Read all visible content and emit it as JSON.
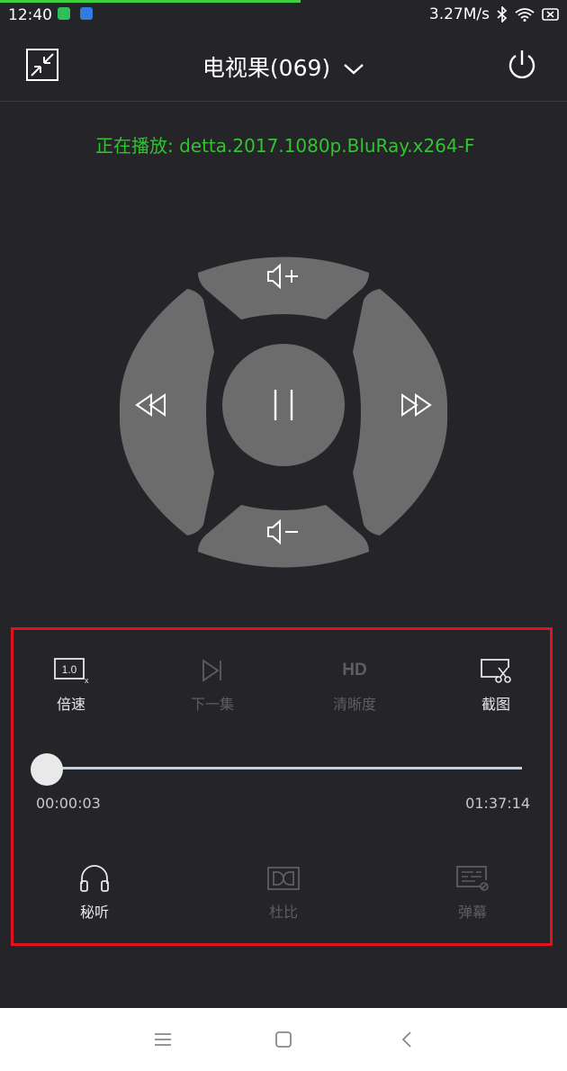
{
  "statusbar": {
    "time": "12:40",
    "speed": "3.27M/s"
  },
  "header": {
    "title": "电视果(069)"
  },
  "now_playing": {
    "text": "正在播放: detta.2017.1080p.BluRay.x264-F"
  },
  "controls": {
    "row1": [
      {
        "label": "倍速",
        "icon_text": "1.0",
        "enabled": true
      },
      {
        "label": "下一集",
        "enabled": false
      },
      {
        "label": "清晰度",
        "icon_text": "HD",
        "enabled": false
      },
      {
        "label": "截图",
        "enabled": true
      }
    ],
    "progress": {
      "current": "00:00:03",
      "total": "01:37:14",
      "fraction": 0.0
    },
    "row2": [
      {
        "label": "秘听",
        "enabled": true
      },
      {
        "label": "杜比",
        "enabled": false
      },
      {
        "label": "弹幕",
        "enabled": false
      }
    ]
  },
  "colors": {
    "accent": "#33c233",
    "highlight_border": "#e0141c",
    "background": "#252529",
    "button": "#6c6c6c"
  }
}
